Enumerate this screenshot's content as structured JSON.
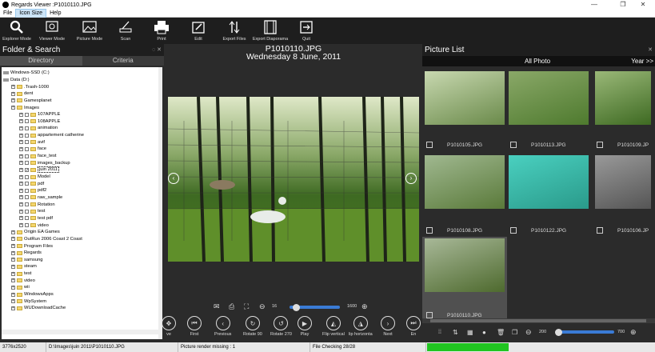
{
  "window": {
    "title": "Regards Viewer :P1010110.JPG",
    "minimize": "—",
    "maximize": "❐",
    "close": "✕"
  },
  "menu": [
    "File",
    "Icon Size",
    "Help"
  ],
  "toolbar": [
    {
      "label": "Explorer Mode",
      "icon": "search-icon"
    },
    {
      "label": "Viewer Mode",
      "icon": "viewer-icon"
    },
    {
      "label": "Picture Mode",
      "icon": "picture-icon"
    },
    {
      "label": "Scan",
      "icon": "scanner-icon"
    },
    {
      "label": "Print",
      "icon": "print-icon"
    },
    {
      "label": "Edit",
      "icon": "edit-icon"
    },
    {
      "label": "Export Files",
      "icon": "export-icon"
    },
    {
      "label": "Export Diaporama",
      "icon": "film-icon"
    },
    {
      "label": "Quit",
      "icon": "quit-icon"
    }
  ],
  "left_panel": {
    "title": "Folder & Search",
    "tabs": [
      "Directory",
      "Criteria"
    ],
    "tree": [
      {
        "label": "Windows-SSD (C:)",
        "type": "drive",
        "level": 0
      },
      {
        "label": "Data (D:)",
        "type": "drive",
        "level": 0
      },
      {
        "label": ".Trash-1000",
        "type": "folder",
        "level": 1
      },
      {
        "label": "dent",
        "type": "folder",
        "level": 1
      },
      {
        "label": "Gamesplanet",
        "type": "folder",
        "level": 1
      },
      {
        "label": "Images",
        "type": "folder",
        "level": 1
      },
      {
        "label": "107APPLE",
        "type": "folder",
        "level": 2
      },
      {
        "label": "108APPLE",
        "type": "folder",
        "level": 2
      },
      {
        "label": "animation",
        "type": "folder",
        "level": 2
      },
      {
        "label": "appartement catherine",
        "type": "folder",
        "level": 2
      },
      {
        "label": "avif",
        "type": "folder",
        "level": 2
      },
      {
        "label": "face",
        "type": "folder",
        "level": 2
      },
      {
        "label": "face_test",
        "type": "folder",
        "level": 2
      },
      {
        "label": "images_backup",
        "type": "folder",
        "level": 2
      },
      {
        "label": "juin 2011",
        "type": "folder",
        "level": 2,
        "checked": true,
        "selected": true
      },
      {
        "label": "Model",
        "type": "folder",
        "level": 2
      },
      {
        "label": "pdf",
        "type": "folder",
        "level": 2
      },
      {
        "label": "pdf2",
        "type": "folder",
        "level": 2
      },
      {
        "label": "raw_sample",
        "type": "folder",
        "level": 2
      },
      {
        "label": "Rotation",
        "type": "folder",
        "level": 2
      },
      {
        "label": "test",
        "type": "folder",
        "level": 2
      },
      {
        "label": "test pdf",
        "type": "folder",
        "level": 2
      },
      {
        "label": "video",
        "type": "folder",
        "level": 2
      },
      {
        "label": "Origin EA Games",
        "type": "folder",
        "level": 1
      },
      {
        "label": "OutRun 2006 Coast 2 Coast",
        "type": "folder",
        "level": 1
      },
      {
        "label": "Program Files",
        "type": "folder",
        "level": 1
      },
      {
        "label": "Regards",
        "type": "folder",
        "level": 1
      },
      {
        "label": "samsung",
        "type": "folder",
        "level": 1
      },
      {
        "label": "steam",
        "type": "folder",
        "level": 1
      },
      {
        "label": "test",
        "type": "folder",
        "level": 1
      },
      {
        "label": "video",
        "type": "folder",
        "level": 1
      },
      {
        "label": "wii",
        "type": "folder",
        "level": 1
      },
      {
        "label": "WindowsApps",
        "type": "folder",
        "level": 1
      },
      {
        "label": "WpSystem",
        "type": "folder",
        "level": 1
      },
      {
        "label": "WUDownloadCache",
        "type": "folder",
        "level": 1
      }
    ]
  },
  "viewer": {
    "filename": "P1010110.JPG",
    "date": "Wednesday 8 June, 2011",
    "zoom_min": "16",
    "zoom_max": "1600",
    "zoom_level": 0.13,
    "controls": [
      {
        "label": "ve",
        "icon": "move-icon"
      },
      {
        "label": "First",
        "icon": "first-icon"
      },
      {
        "label": "Previous",
        "icon": "previous-icon"
      },
      {
        "label": "Rotate 90",
        "icon": "rotate-right-icon"
      },
      {
        "label": "Rotate 270",
        "icon": "rotate-left-icon"
      },
      {
        "label": "Play",
        "icon": "play-icon"
      },
      {
        "label": "Flip vertical",
        "icon": "flip-vertical-icon"
      },
      {
        "label": "lip horizonta",
        "icon": "flip-horizontal-icon"
      },
      {
        "label": "Next",
        "icon": "next-icon"
      },
      {
        "label": "En",
        "icon": "last-icon"
      }
    ]
  },
  "right_panel": {
    "title": "Picture List",
    "subtitle": "All Photo",
    "year_button": "Year >>",
    "pictures": [
      {
        "name": "",
        "row": 0,
        "col": 0
      },
      {
        "name": "",
        "row": 0,
        "col": 1
      },
      {
        "name": "",
        "row": 0,
        "col": 2
      },
      {
        "name": "P1010105.JPG",
        "row": 1,
        "col": 0
      },
      {
        "name": "P1010113.JPG",
        "row": 1,
        "col": 1
      },
      {
        "name": "P1010109.JP",
        "row": 1,
        "col": 2
      },
      {
        "name": "P1010108.JPG",
        "row": 2,
        "col": 0
      },
      {
        "name": "P1010122.JPG",
        "row": 2,
        "col": 1
      },
      {
        "name": "P1010106.JP",
        "row": 2,
        "col": 2
      },
      {
        "name": "P1010110.JPG",
        "row": 3,
        "col": 0
      }
    ],
    "thumb_min": "200",
    "thumb_max": "700",
    "thumb_level": 0.0
  },
  "status": {
    "resolution": "3776x2520",
    "path": "D:\\Images\\juin 2011\\P1010110.JPG",
    "render": "Picture render missing : 1",
    "checking": "File Checking 28/28"
  }
}
